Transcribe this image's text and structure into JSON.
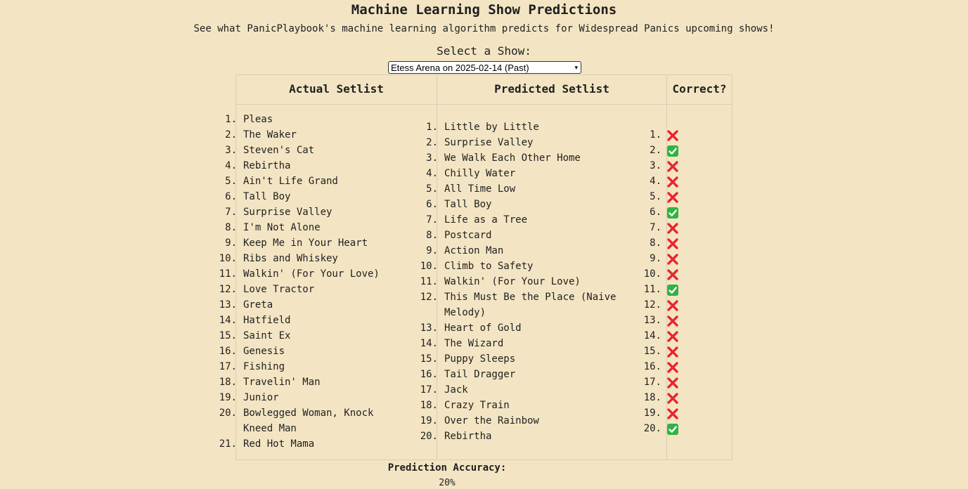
{
  "page": {
    "title": "Machine Learning Show Predictions",
    "subtitle": "See what PanicPlaybook's machine learning algorithm predicts for Widespread Panics upcoming shows!"
  },
  "show_selector": {
    "label": "Select a Show:",
    "selected": "Etess Arena on 2025-02-14 (Past)"
  },
  "table": {
    "headers": {
      "actual": "Actual Setlist",
      "predicted": "Predicted Setlist",
      "correct": "Correct?"
    },
    "actual_setlist": [
      "Pleas",
      "The Waker",
      "Steven's Cat",
      "Rebirtha",
      "Ain't Life Grand",
      "Tall Boy",
      "Surprise Valley",
      "I'm Not Alone",
      "Keep Me in Your Heart",
      "Ribs and Whiskey",
      "Walkin' (For Your Love)",
      "Love Tractor",
      "Greta",
      "Hatfield",
      "Saint Ex",
      "Genesis",
      "Fishing",
      "Travelin' Man",
      "Junior",
      "Bowlegged Woman, Knock Kneed Man",
      "Red Hot Mama"
    ],
    "predicted_setlist": [
      "Little by Little",
      "Surprise Valley",
      "We Walk Each Other Home",
      "Chilly Water",
      "All Time Low",
      "Tall Boy",
      "Life as a Tree",
      "Postcard",
      "Action Man",
      "Climb to Safety",
      "Walkin' (For Your Love)",
      "This Must Be the Place (Naive Melody)",
      "Heart of Gold",
      "The Wizard",
      "Puppy Sleeps",
      "Tail Dragger",
      "Jack",
      "Crazy Train",
      "Over the Rainbow",
      "Rebirtha"
    ],
    "correct": [
      false,
      true,
      false,
      false,
      false,
      true,
      false,
      false,
      false,
      false,
      true,
      false,
      false,
      false,
      false,
      false,
      false,
      false,
      false,
      true
    ]
  },
  "accuracy": {
    "label": "Prediction Accuracy:",
    "value": "20%"
  },
  "colors": {
    "background": "#f3e5c3",
    "grid": "#d8ceb5",
    "correct_icon": "#2fb344",
    "incorrect_icon": "#e8262f"
  },
  "icons": {
    "correct": "check-box-icon",
    "incorrect": "cross-mark-icon"
  }
}
